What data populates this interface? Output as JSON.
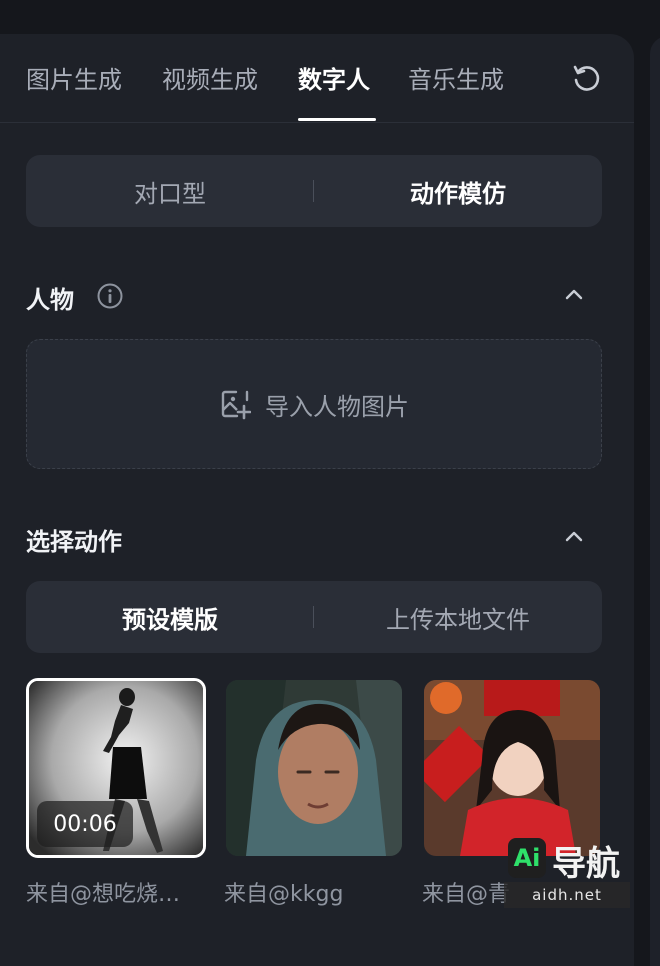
{
  "tabs": [
    {
      "label": "图片生成"
    },
    {
      "label": "视频生成"
    },
    {
      "label": "数字人",
      "active": true
    },
    {
      "label": "音乐生成"
    }
  ],
  "mode_segment": {
    "options": [
      "对口型",
      "动作模仿"
    ],
    "selected": "动作模仿"
  },
  "person_section": {
    "title": "人物",
    "upload_label": "导入人物图片"
  },
  "action_section": {
    "title": "选择动作",
    "source_options": [
      "预设模版",
      "上传本地文件"
    ],
    "selected_source": "预设模版"
  },
  "templates": [
    {
      "caption": "来自@想吃烧…",
      "duration": "00:06",
      "selected": true
    },
    {
      "caption": "来自@kkgg"
    },
    {
      "caption": "来自@青"
    }
  ],
  "watermark": {
    "badge": "Ai",
    "text": "导航",
    "url": "aidh.net"
  },
  "colors": {
    "background": "#15171c",
    "panel": "#1e2128",
    "segment": "#2a2e37",
    "active_text": "#ffffff",
    "inactive_text": "#a8adb8"
  }
}
